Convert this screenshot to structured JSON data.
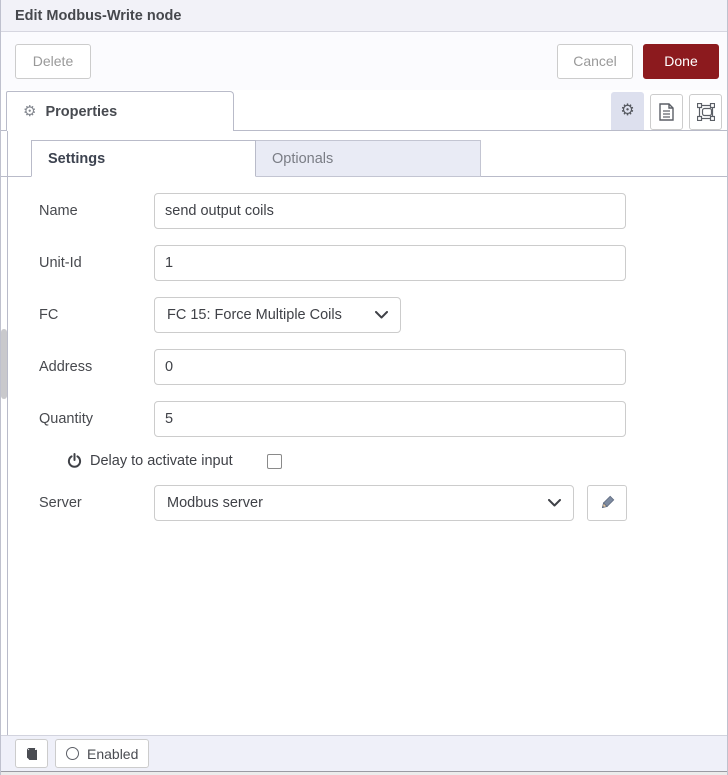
{
  "header": {
    "title": "Edit Modbus-Write node"
  },
  "toolbar": {
    "delete_label": "Delete",
    "cancel_label": "Cancel",
    "done_label": "Done"
  },
  "properties_tab": {
    "label": "Properties"
  },
  "subtabs": {
    "settings_label": "Settings",
    "optionals_label": "Optionals"
  },
  "form": {
    "name": {
      "label": "Name",
      "value": "send output coils"
    },
    "unit_id": {
      "label": "Unit-Id",
      "value": "1"
    },
    "fc": {
      "label": "FC",
      "value": "FC 15: Force Multiple Coils"
    },
    "address": {
      "label": "Address",
      "value": "0"
    },
    "quantity": {
      "label": "Quantity",
      "value": "5"
    },
    "delay": {
      "label": "Delay to activate input",
      "checked": false
    },
    "server": {
      "label": "Server",
      "value": "Modbus server"
    }
  },
  "footer": {
    "enabled_label": "Enabled"
  },
  "icons": {
    "properties_tab": "gear-icon",
    "toolbar_icons": [
      "gear-icon",
      "document-icon",
      "appearance-icon"
    ],
    "delay": "power-icon",
    "server_edit": "pencil-icon",
    "footer": [
      "book-icon",
      "circle-icon"
    ]
  },
  "colors": {
    "done_button_bg": "#8C1A1E",
    "inactive_tab_bg": "#e9ebf5",
    "footer_bg": "#eff0f9",
    "active_icon_btn_bg": "#dde0ee"
  }
}
